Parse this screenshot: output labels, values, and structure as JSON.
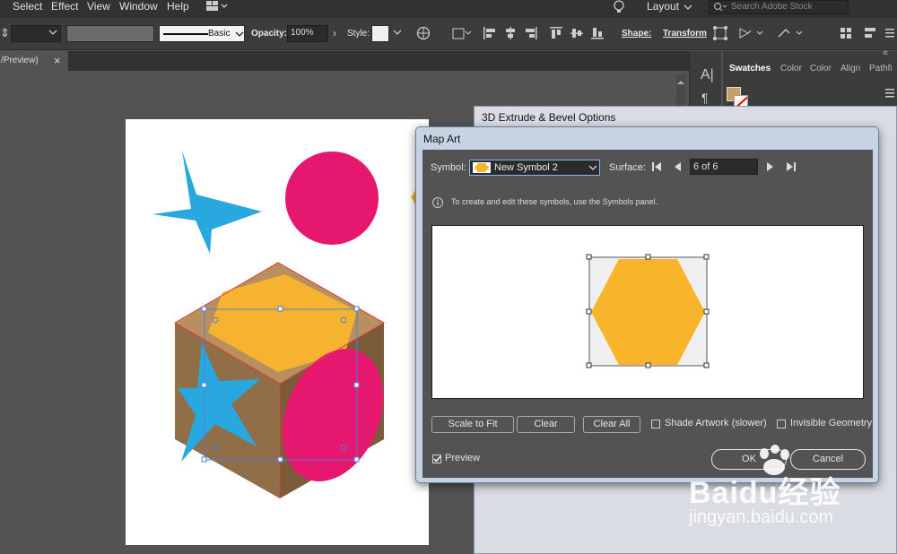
{
  "menubar": {
    "items": [
      "Select",
      "Effect",
      "View",
      "Window",
      "Help"
    ],
    "layout_label": "Layout",
    "search_placeholder": "Search Adobe Stock"
  },
  "control_bar": {
    "stroke_style": "Basic",
    "opacity_label": "Opacity:",
    "opacity_value": "100%",
    "style_label": "Style:",
    "shape_label": "Shape:",
    "transform_label": "Transform"
  },
  "doc_tab": {
    "title": "/Preview)",
    "close": "×"
  },
  "panels": {
    "tabs": [
      "Swatches",
      "Color",
      "Color",
      "Align",
      "Pathfi"
    ],
    "collapse": "«",
    "swatch_color": "#c8a065"
  },
  "bevel_dialog": {
    "title": "3D Extrude & Bevel Options"
  },
  "map_art": {
    "title": "Map Art",
    "symbol_label": "Symbol:",
    "symbol_value": "New Symbol 2",
    "surface_label": "Surface:",
    "surface_value": "6 of 6",
    "info_text": "To create and edit these symbols, use the Symbols panel.",
    "buttons": {
      "scale_to_fit": "Scale to Fit",
      "clear": "Clear",
      "clear_all": "Clear All",
      "ok": "OK",
      "cancel": "Cancel"
    },
    "shade_artwork_label": "Shade Artwork (slower)",
    "shade_artwork_checked": false,
    "invisible_geometry_label": "Invisible Geometry",
    "invisible_geometry_checked": false,
    "preview_label": "Preview",
    "preview_checked": true
  },
  "colors": {
    "star": "#29a8e0",
    "circle": "#e5176e",
    "hexagon": "#f8b52c",
    "cube": "#8f6e48"
  },
  "watermark": {
    "brand": "Baidu经验",
    "url": "jingyan.baidu.com"
  }
}
